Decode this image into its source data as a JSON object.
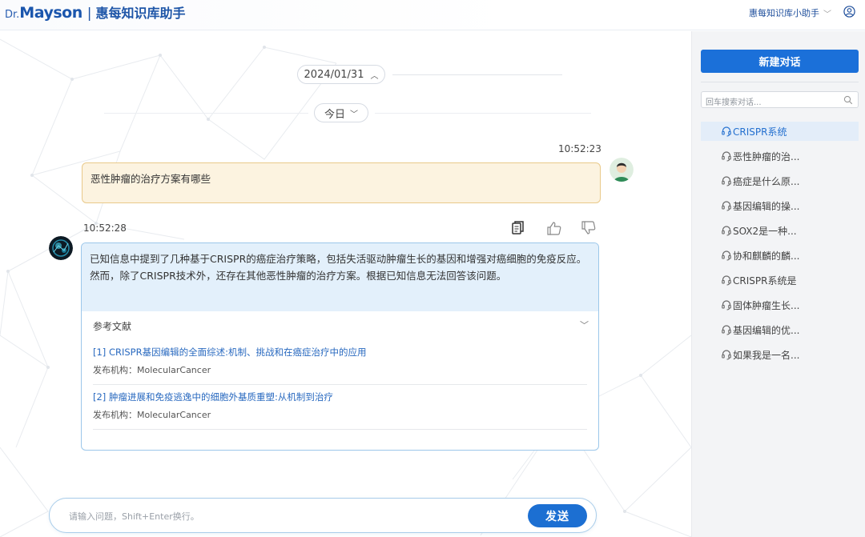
{
  "header": {
    "logo_dr": "Dr.",
    "logo_mayson": "Mayson",
    "logo_separator": "|",
    "title": "惠每知识库助手",
    "user_menu_label": "惠每知识库小助手"
  },
  "chat": {
    "date_label": "2024/01/31",
    "today_label": "今日",
    "user_message": {
      "time": "10:52:23",
      "text": "恶性肿瘤的治疗方案有哪些"
    },
    "bot_message": {
      "time": "10:52:28",
      "text": "已知信息中提到了几种基于CRISPR的癌症治疗策略，包括失活驱动肿瘤生长的基因和增强对癌细胞的免疫反应。然而，除了CRISPR技术外，还存在其他恶性肿瘤的治疗方案。根据已知信息无法回答该问题。",
      "references_label": "参考文献",
      "references": [
        {
          "title": "[1] CRISPR基因编辑的全面综述:机制、挑战和在癌症治疗中的应用",
          "publisher": "发布机构：MolecularCancer"
        },
        {
          "title": "[2] 肿瘤进展和免疫逃逸中的细胞外基质重塑:从机制到治疗",
          "publisher": "发布机构：MolecularCancer"
        }
      ]
    },
    "input": {
      "placeholder": "请输入问题，Shift+Enter换行。",
      "send_label": "发送"
    }
  },
  "sidebar": {
    "new_chat_label": "新建对话",
    "search_placeholder": "回车搜索对话...",
    "conversations": [
      {
        "label": "CRISPR系统",
        "active": true
      },
      {
        "label": "恶性肿瘤的治...",
        "active": false
      },
      {
        "label": "癌症是什么原...",
        "active": false
      },
      {
        "label": "基因编辑的操...",
        "active": false
      },
      {
        "label": "SOX2是一种...",
        "active": false
      },
      {
        "label": "协和麒麟的麟...",
        "active": false
      },
      {
        "label": "CRISPR系统是",
        "active": false
      },
      {
        "label": "固体肿瘤生长...",
        "active": false
      },
      {
        "label": "基因编辑的优...",
        "active": false
      },
      {
        "label": "如果我是一名...",
        "active": false
      }
    ]
  },
  "colors": {
    "brand": "#1b70d9",
    "user_bubble_bg": "#fcf3e0",
    "bot_bubble_bg": "#e3f0fb",
    "link": "#2a6ac0"
  }
}
